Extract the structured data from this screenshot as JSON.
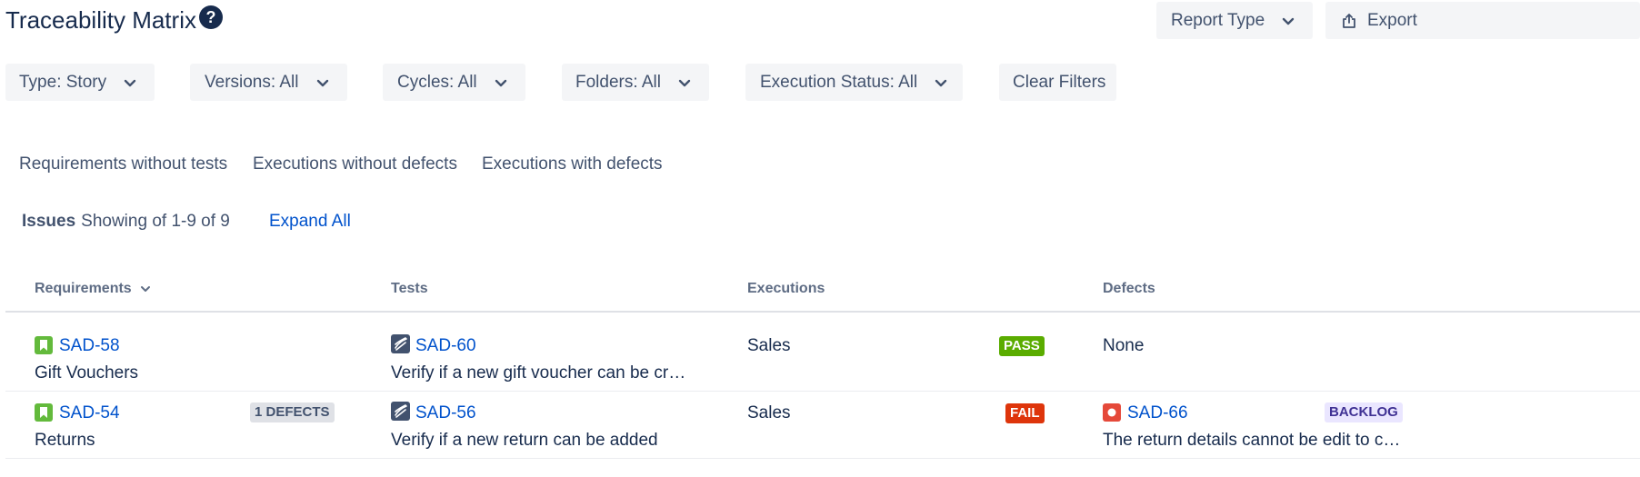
{
  "header": {
    "title": "Traceability Matrix",
    "report_type_label": "Report Type",
    "export_label": "Export"
  },
  "filters": {
    "type": "Type: Story",
    "versions": "Versions: All",
    "cycles": "Cycles: All",
    "folders": "Folders: All",
    "execution_status": "Execution Status: All",
    "clear": "Clear Filters"
  },
  "tabs": [
    "Requirements without tests",
    "Executions without defects",
    "Executions with defects"
  ],
  "issues": {
    "label": "Issues",
    "count_text": "Showing of 1-9 of 9",
    "expand_all": "Expand All"
  },
  "columns": {
    "requirements": "Requirements",
    "tests": "Tests",
    "executions": "Executions",
    "defects": "Defects"
  },
  "rows": [
    {
      "req_key": "SAD-58",
      "req_summary": "Gift Vouchers",
      "test_key": "SAD-60",
      "test_summary": "Verify if a new gift voucher can be cre…",
      "execution": "Sales",
      "status": "PASS",
      "defect_text": "None"
    },
    {
      "req_key": "SAD-54",
      "req_summary": "Returns",
      "defects_badge": "1 DEFECTS",
      "test_key": "SAD-56",
      "test_summary": "Verify if a new return can be added",
      "execution": "Sales",
      "status": "FAIL",
      "defect_key": "SAD-66",
      "defect_summary": "The return details cannot be edit to cr…",
      "defect_status": "BACKLOG"
    }
  ],
  "icons": {
    "help": "question-circle-icon",
    "export": "share-upload-icon",
    "story": "story-bookmark-icon",
    "test": "test-flag-icon",
    "bug": "bug-icon",
    "chevron": "chevron-down-icon"
  },
  "colors": {
    "link": "#0052cc",
    "pass": "#5aac00",
    "fail": "#de350b",
    "story": "#63ba3c",
    "bug": "#e5493a",
    "backlog_bg": "#eae6ff"
  }
}
